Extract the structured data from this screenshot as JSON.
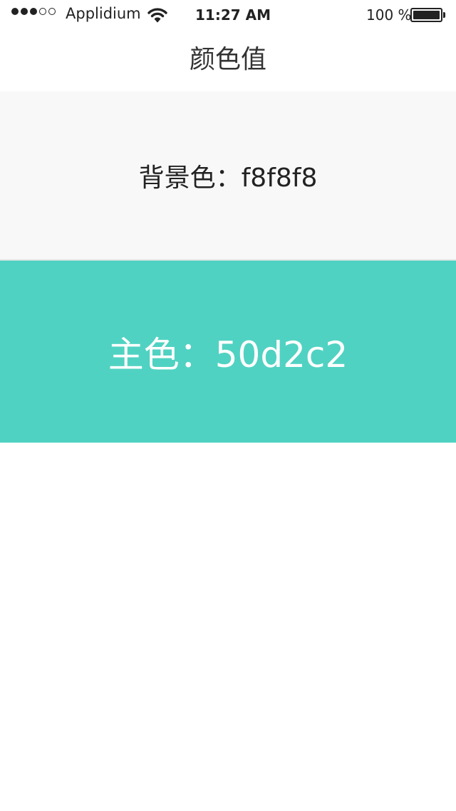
{
  "status_bar": {
    "carrier": "Applidium",
    "signal_strength": 3,
    "signal_total": 5,
    "time": "11:27 AM",
    "battery_percent_text": "100 %",
    "battery_level": 1.0,
    "icons": [
      "signal-dots-icon",
      "wifi-icon",
      "battery-icon"
    ]
  },
  "nav": {
    "title": "颜色值"
  },
  "swatches": {
    "background": {
      "label": "背景色：f8f8f8",
      "color": "#f8f8f8"
    },
    "primary": {
      "label": "主色：50d2c2",
      "color": "#50d2c2"
    }
  },
  "colors": {
    "page": "#ffffff",
    "text": "#222222",
    "divider": "#e6e6e6"
  }
}
